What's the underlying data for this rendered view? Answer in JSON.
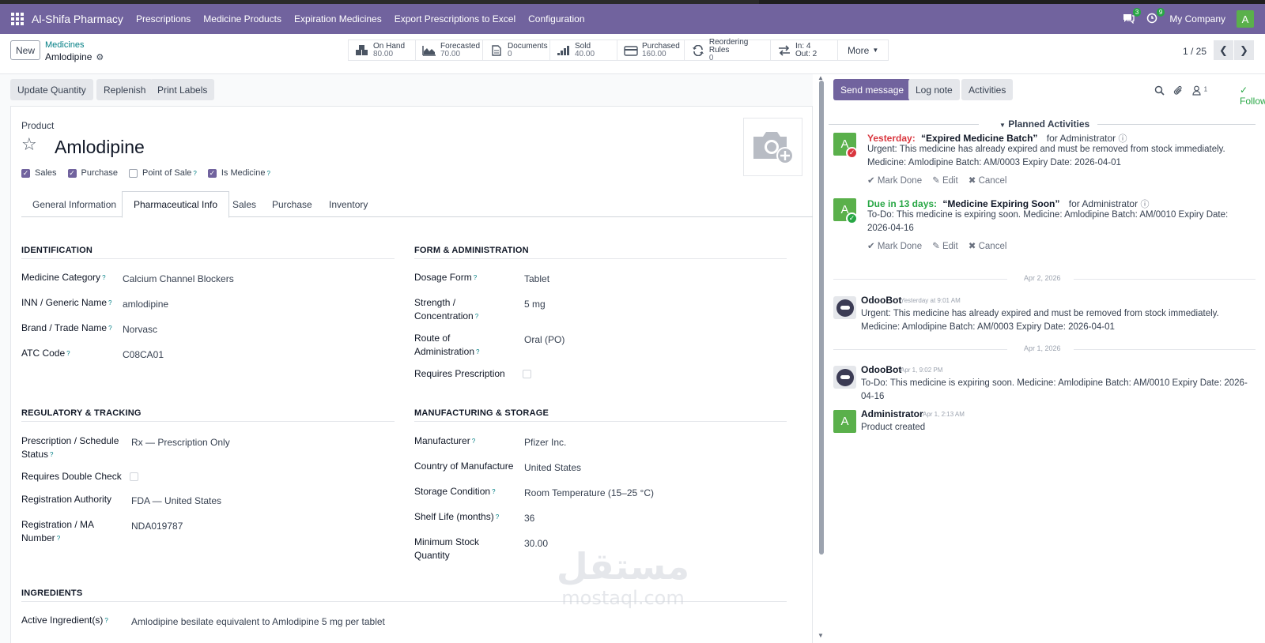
{
  "navbar": {
    "app_name": "Al-Shifa Pharmacy",
    "menus": [
      "Prescriptions",
      "Medicine Products",
      "Expiration Medicines",
      "Export Prescriptions to Excel",
      "Configuration"
    ],
    "messages_count": "3",
    "activities_count": "9",
    "company": "My Company",
    "avatar_letter": "A"
  },
  "control": {
    "new_label": "New",
    "breadcrumb_parent": "Medicines",
    "breadcrumb_current": "Amlodipine",
    "pager": "1 / 25",
    "smart_buttons": [
      {
        "label": "On Hand",
        "value": "80.00",
        "icon": "cubes-icon"
      },
      {
        "label": "Forecasted",
        "value": "70.00",
        "icon": "area-chart-icon"
      },
      {
        "label": "Documents",
        "value": "0",
        "icon": "file-icon"
      },
      {
        "label": "Sold",
        "value": "40.00",
        "icon": "signal-icon"
      },
      {
        "label": "Purchased",
        "value": "160.00",
        "icon": "credit-card-icon"
      },
      {
        "label": "Reordering Rules",
        "value": "0",
        "icon": "refresh-icon"
      },
      {
        "label": "In: 4",
        "value": "Out: 2",
        "icon": "exchange-icon"
      }
    ],
    "more_label": "More"
  },
  "actions": {
    "update_qty": "Update Quantity",
    "replenish": "Replenish",
    "print_labels": "Print Labels"
  },
  "product": {
    "label": "Product",
    "name": "Amlodipine",
    "checkboxes": [
      {
        "label": "Sales",
        "checked": true
      },
      {
        "label": "Purchase",
        "checked": true
      },
      {
        "label": "Point of Sale",
        "checked": false
      },
      {
        "label": "Is Medicine",
        "checked": true
      }
    ],
    "tabs": [
      "General Information",
      "Pharmaceutical Info",
      "Sales",
      "Purchase",
      "Inventory"
    ]
  },
  "identification": {
    "title": "IDENTIFICATION",
    "fields": [
      {
        "label": "Medicine Category",
        "value": "Calcium Channel Blockers"
      },
      {
        "label": "INN / Generic Name",
        "value": "amlodipine"
      },
      {
        "label": "Brand / Trade Name",
        "value": "Norvasc"
      },
      {
        "label": "ATC Code",
        "value": "C08CA01"
      }
    ]
  },
  "form_admin": {
    "title": "FORM & ADMINISTRATION",
    "dosage_form": {
      "label": "Dosage Form",
      "value": "Tablet"
    },
    "strength": {
      "label1": "Strength /",
      "label2": "Concentration",
      "value": "5 mg"
    },
    "route": {
      "label1": "Route of",
      "label2": "Administration",
      "value": "Oral (PO)"
    },
    "requires_rx": {
      "label": "Requires Prescription"
    }
  },
  "regulatory": {
    "title": "REGULATORY & TRACKING",
    "schedule": {
      "label1": "Prescription / Schedule",
      "label2": "Status",
      "value": "Rx — Prescription Only"
    },
    "double_check": {
      "label": "Requires Double Check"
    },
    "authority": {
      "label": "Registration Authority",
      "value": "FDA — United States"
    },
    "ma_number": {
      "label1": "Registration / MA",
      "label2": "Number",
      "value": "NDA019787"
    }
  },
  "manufacturing": {
    "title": "MANUFACTURING & STORAGE",
    "manufacturer": {
      "label": "Manufacturer",
      "value": "Pfizer Inc."
    },
    "country": {
      "label": "Country of Manufacture",
      "value": "United States"
    },
    "storage": {
      "label": "Storage Condition",
      "value": "Room Temperature (15–25 °C)"
    },
    "shelf_life": {
      "label": "Shelf Life (months)",
      "value": "36"
    },
    "min_stock": {
      "label1": "Minimum Stock",
      "label2": "Quantity",
      "value": "30.00"
    }
  },
  "ingredients": {
    "title": "INGREDIENTS",
    "active": {
      "label": "Active Ingredient(s)",
      "value": "Amlodipine besilate equivalent to Amlodipine 5 mg per tablet"
    }
  },
  "chatter": {
    "send_message": "Send message",
    "log_note": "Log note",
    "activities": "Activities",
    "followers_count": "1",
    "following": "Following",
    "planned_title": "Planned Activities",
    "activity1": {
      "when": "Yesterday:",
      "title": "“Expired Medicine Batch”",
      "for": "for Administrator",
      "line1": "Urgent: This medicine has already expired and must be removed from stock immediately.",
      "line2": "Medicine: Amlodipine Batch: AM/0003 Expiry Date: 2026-04-01"
    },
    "activity2": {
      "when": "Due in 13 days:",
      "title": "“Medicine Expiring Soon”",
      "for": "for Administrator",
      "line1": "To-Do: This medicine is expiring soon. Medicine: Amlodipine Batch: AM/0010 Expiry Date:",
      "line2": "2026-04-16"
    },
    "links": {
      "done": "Mark Done",
      "edit": "Edit",
      "cancel": "Cancel"
    },
    "date1": "Apr 2, 2026",
    "msg1": {
      "author": "OdooBot",
      "time": "Yesterday at 9:01 AM",
      "line1": "Urgent: This medicine has already expired and must be removed from stock immediately.",
      "line2": "Medicine: Amlodipine Batch: AM/0003 Expiry Date: 2026-04-01"
    },
    "date2": "Apr 1, 2026",
    "msg2": {
      "author": "OdooBot",
      "time": "Apr 1, 9:02 PM",
      "line1": "To-Do: This medicine is expiring soon. Medicine: Amlodipine Batch: AM/0010 Expiry Date: 2026-",
      "line2": "04-16"
    },
    "msg3": {
      "author": "Administrator",
      "time": "Apr 1, 2:13 AM",
      "line1": "Product created",
      "avatar": "A"
    }
  },
  "watermark": {
    "arabic": "مستقل",
    "latin": "mostaql.com"
  },
  "colors": {
    "brand": "#71639e",
    "overdue": "#d9363e",
    "upcoming": "#28a745",
    "link": "#017e84"
  }
}
